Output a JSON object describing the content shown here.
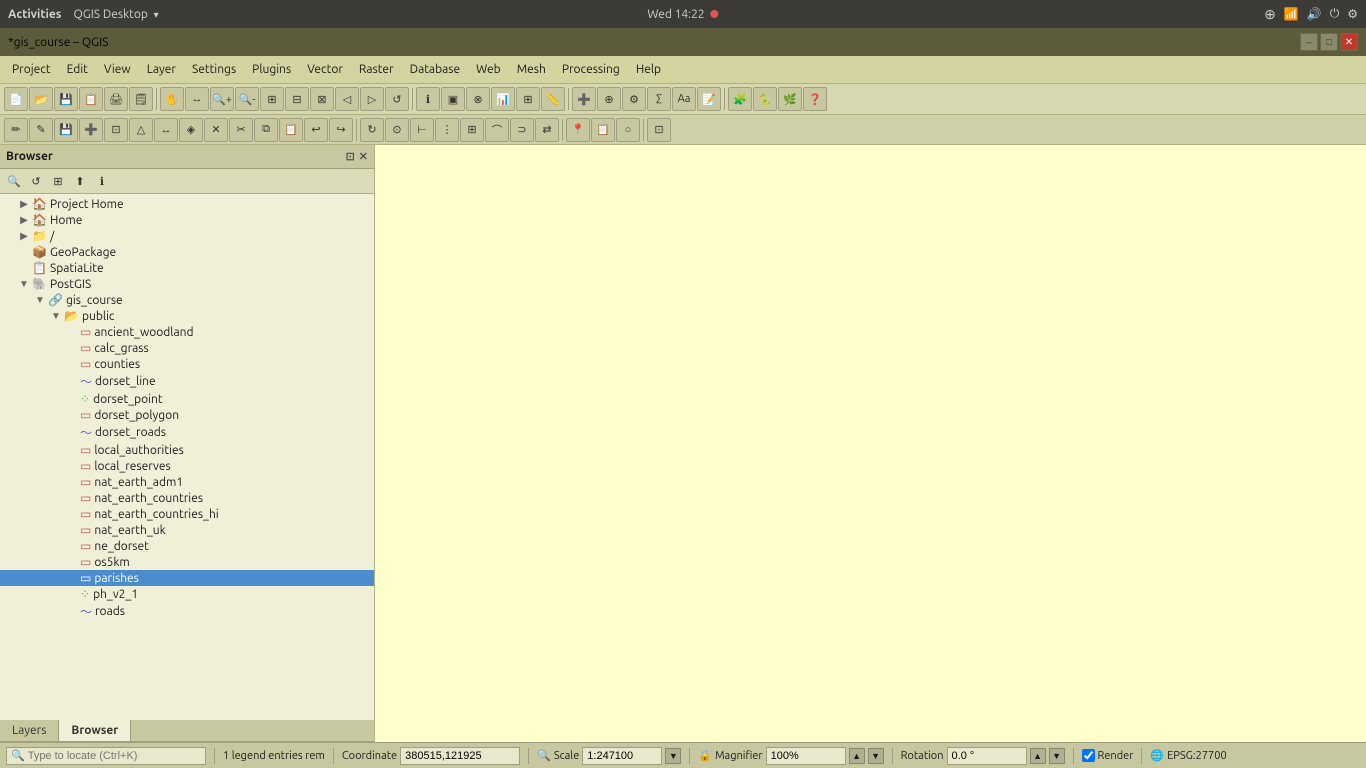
{
  "system_bar": {
    "activities": "Activities",
    "app_name": "QGIS Desktop",
    "datetime": "Wed 14:22",
    "indicator": "●"
  },
  "title_bar": {
    "title": "*gis_course – QGIS",
    "minimize": "–",
    "maximize": "□",
    "close": "✕"
  },
  "menu": {
    "items": [
      "Project",
      "Edit",
      "View",
      "Layer",
      "Settings",
      "Plugins",
      "Vector",
      "Raster",
      "Database",
      "Web",
      "Mesh",
      "Processing",
      "Help"
    ]
  },
  "browser_panel": {
    "title": "Browser",
    "toolbar_icons": [
      "🔍",
      "↺",
      "⊞",
      "⬆",
      "ℹ"
    ],
    "tree": [
      {
        "id": "project-home",
        "label": "Project Home",
        "indent": 1,
        "expand": "▶",
        "icon": "🏠"
      },
      {
        "id": "home",
        "label": "Home",
        "indent": 1,
        "expand": "▶",
        "icon": "🏠"
      },
      {
        "id": "root",
        "label": "/",
        "indent": 1,
        "expand": "▶",
        "icon": "📁"
      },
      {
        "id": "geopackage",
        "label": "GeoPackage",
        "indent": 1,
        "expand": "",
        "icon": "📦"
      },
      {
        "id": "spatialite",
        "label": "SpatiaLite",
        "indent": 1,
        "expand": "",
        "icon": "📋"
      },
      {
        "id": "postgis",
        "label": "PostGIS",
        "indent": 1,
        "expand": "▼",
        "icon": "🐘"
      },
      {
        "id": "gis_course",
        "label": "gis_course",
        "indent": 2,
        "expand": "▼",
        "icon": "🔗"
      },
      {
        "id": "public",
        "label": "public",
        "indent": 3,
        "expand": "▼",
        "icon": "📂"
      },
      {
        "id": "ancient_woodland",
        "label": "ancient_woodland",
        "indent": 4,
        "expand": "",
        "icon": "▭",
        "type": "polygon"
      },
      {
        "id": "calc_grass",
        "label": "calc_grass",
        "indent": 4,
        "expand": "",
        "icon": "▭",
        "type": "polygon"
      },
      {
        "id": "counties",
        "label": "counties",
        "indent": 4,
        "expand": "",
        "icon": "▭",
        "type": "polygon"
      },
      {
        "id": "dorset_line",
        "label": "dorset_line",
        "indent": 4,
        "expand": "",
        "icon": "∿",
        "type": "line"
      },
      {
        "id": "dorset_point",
        "label": "dorset_point",
        "indent": 4,
        "expand": "",
        "icon": "·",
        "type": "point"
      },
      {
        "id": "dorset_polygon",
        "label": "dorset_polygon",
        "indent": 4,
        "expand": "",
        "icon": "▭",
        "type": "polygon"
      },
      {
        "id": "dorset_roads",
        "label": "dorset_roads",
        "indent": 4,
        "expand": "",
        "icon": "∿",
        "type": "line"
      },
      {
        "id": "local_authorities",
        "label": "local_authorities",
        "indent": 4,
        "expand": "",
        "icon": "▭",
        "type": "polygon"
      },
      {
        "id": "local_reserves",
        "label": "local_reserves",
        "indent": 4,
        "expand": "",
        "icon": "▭",
        "type": "polygon"
      },
      {
        "id": "nat_earth_adm1",
        "label": "nat_earth_adm1",
        "indent": 4,
        "expand": "",
        "icon": "▭",
        "type": "polygon"
      },
      {
        "id": "nat_earth_countries",
        "label": "nat_earth_countries",
        "indent": 4,
        "expand": "",
        "icon": "▭",
        "type": "polygon"
      },
      {
        "id": "nat_earth_countries_hi",
        "label": "nat_earth_countries_hi",
        "indent": 4,
        "expand": "",
        "icon": "▭",
        "type": "polygon"
      },
      {
        "id": "nat_earth_uk",
        "label": "nat_earth_uk",
        "indent": 4,
        "expand": "",
        "icon": "▭",
        "type": "polygon"
      },
      {
        "id": "ne_dorset",
        "label": "ne_dorset",
        "indent": 4,
        "expand": "",
        "icon": "▭",
        "type": "polygon"
      },
      {
        "id": "os5km",
        "label": "os5km",
        "indent": 4,
        "expand": "",
        "icon": "▭",
        "type": "polygon"
      },
      {
        "id": "parishes",
        "label": "parishes",
        "indent": 4,
        "expand": "",
        "icon": "▭",
        "type": "polygon",
        "selected": true
      },
      {
        "id": "ph_v2_1",
        "label": "ph_v2_1",
        "indent": 4,
        "expand": "",
        "icon": "·",
        "type": "point"
      },
      {
        "id": "roads",
        "label": "roads",
        "indent": 4,
        "expand": "",
        "icon": "∿",
        "type": "line"
      }
    ]
  },
  "bottom_tabs": [
    {
      "id": "layers",
      "label": "Layers",
      "active": false
    },
    {
      "id": "browser",
      "label": "Browser",
      "active": true
    }
  ],
  "status_bar": {
    "legend_text": "1 legend entries rem",
    "coordinate_label": "Coordinate",
    "coordinate_value": "380515,121925",
    "scale_label": "Scale",
    "scale_value": "1:247100",
    "magnifier_label": "Magnifier",
    "magnifier_value": "100%",
    "rotation_label": "Rotation",
    "rotation_value": "0.0 °",
    "render_label": "Render",
    "render_checked": true,
    "epsg_label": "EPSG:27700",
    "locate_placeholder": "Type to locate (Ctrl+K)"
  }
}
